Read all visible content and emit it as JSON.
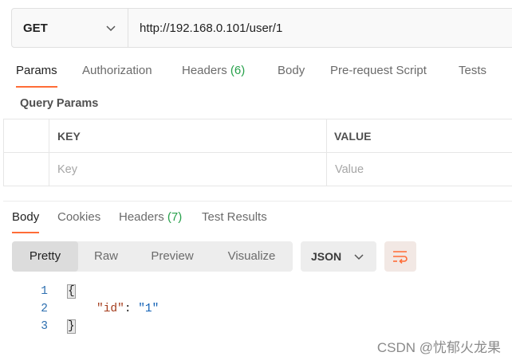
{
  "request": {
    "method": "GET",
    "url": "http://192.168.0.101/user/1"
  },
  "request_tabs": [
    {
      "label": "Params",
      "count": ""
    },
    {
      "label": "Authorization",
      "count": ""
    },
    {
      "label": "Headers",
      "count": "(6)"
    },
    {
      "label": "Body",
      "count": ""
    },
    {
      "label": "Pre-request Script",
      "count": ""
    },
    {
      "label": "Tests",
      "count": ""
    }
  ],
  "query_params": {
    "title": "Query Params",
    "key_header": "KEY",
    "value_header": "VALUE",
    "key_placeholder": "Key",
    "value_placeholder": "Value"
  },
  "response_tabs": [
    {
      "label": "Body",
      "count": ""
    },
    {
      "label": "Cookies",
      "count": ""
    },
    {
      "label": "Headers",
      "count": "(7)"
    },
    {
      "label": "Test Results",
      "count": ""
    }
  ],
  "view": {
    "options": [
      "Pretty",
      "Raw",
      "Preview",
      "Visualize"
    ],
    "selected": "Pretty",
    "format": "JSON"
  },
  "code": {
    "line_numbers": [
      "1",
      "2",
      "3"
    ],
    "open_brace": "{",
    "key": "\"id\"",
    "colon": ": ",
    "value": "\"1\"",
    "close_brace": "}"
  },
  "watermark": "CSDN @忧郁火龙果",
  "colors": {
    "accent": "#ff6c37",
    "count": "#26a04a"
  }
}
